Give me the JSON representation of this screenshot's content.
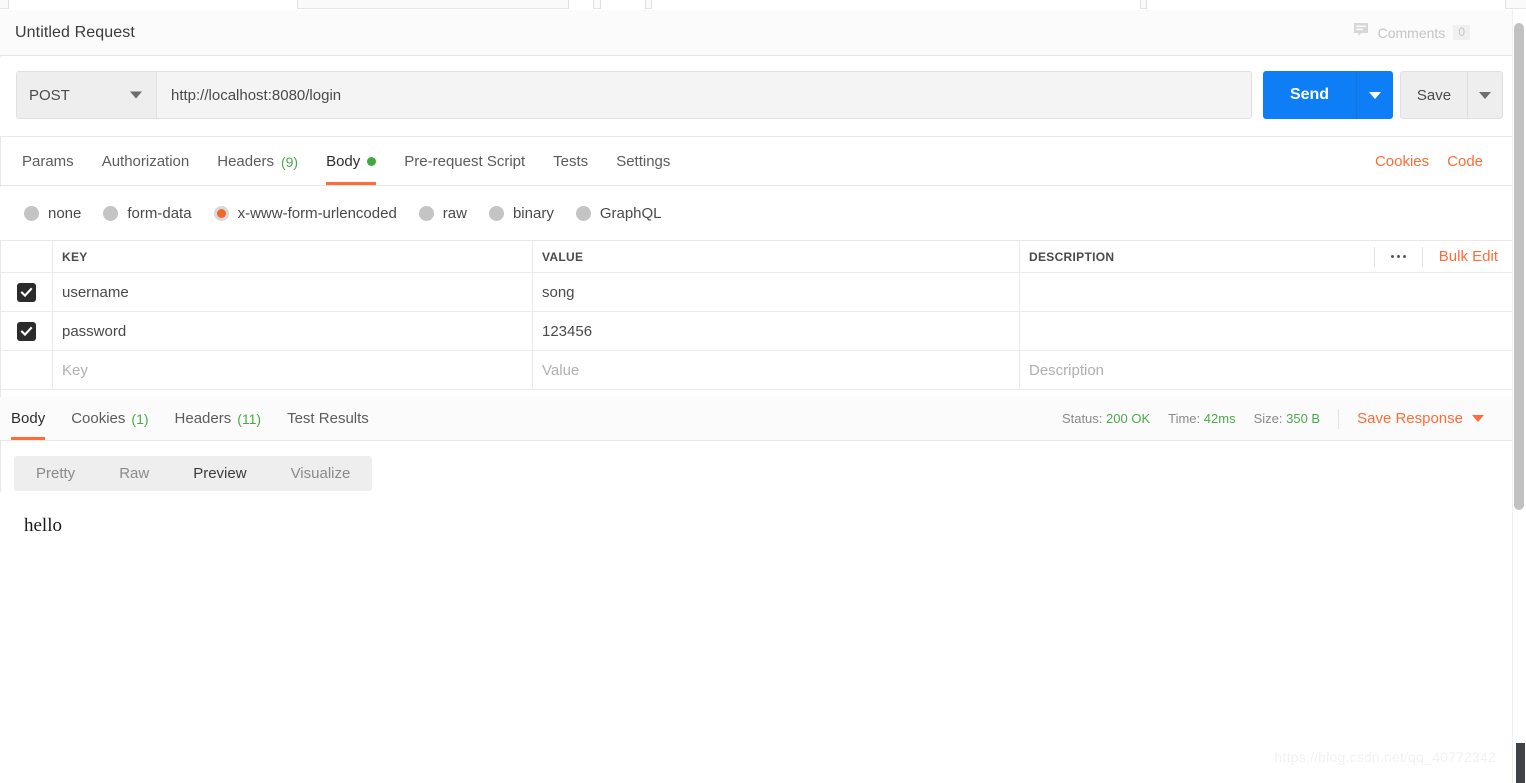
{
  "request": {
    "title": "Untitled Request",
    "comments": {
      "icon": "comment-bubble-icon",
      "label": "Comments",
      "count": "0"
    },
    "method": "POST",
    "url": "http://localhost:8080/login",
    "send_label": "Send",
    "save_label": "Save"
  },
  "request_tabs": [
    {
      "label": "Params",
      "count": "",
      "active": false,
      "dot": false
    },
    {
      "label": "Authorization",
      "count": "",
      "active": false,
      "dot": false
    },
    {
      "label": "Headers",
      "count": "(9)",
      "active": false,
      "dot": false
    },
    {
      "label": "Body",
      "count": "",
      "active": true,
      "dot": true
    },
    {
      "label": "Pre-request Script",
      "count": "",
      "active": false,
      "dot": false
    },
    {
      "label": "Tests",
      "count": "",
      "active": false,
      "dot": false
    },
    {
      "label": "Settings",
      "count": "",
      "active": false,
      "dot": false
    }
  ],
  "tabs_right": {
    "cookies": "Cookies",
    "code": "Code"
  },
  "body_types": [
    {
      "label": "none",
      "selected": false
    },
    {
      "label": "form-data",
      "selected": false
    },
    {
      "label": "x-www-form-urlencoded",
      "selected": true
    },
    {
      "label": "raw",
      "selected": false
    },
    {
      "label": "binary",
      "selected": false
    },
    {
      "label": "GraphQL",
      "selected": false
    }
  ],
  "params_table": {
    "headers": {
      "key": "KEY",
      "value": "VALUE",
      "description": "DESCRIPTION"
    },
    "more_icon": "ellipsis-icon",
    "bulk_edit": "Bulk Edit",
    "rows": [
      {
        "checked": true,
        "key": "username",
        "value": "song",
        "description": "",
        "placeholder": false
      },
      {
        "checked": true,
        "key": "password",
        "value": "123456",
        "description": "",
        "placeholder": false
      },
      {
        "checked": false,
        "key": "Key",
        "value": "Value",
        "description": "Description",
        "placeholder": true
      }
    ]
  },
  "response_tabs": [
    {
      "label": "Body",
      "count": "",
      "active": true
    },
    {
      "label": "Cookies",
      "count": "(1)",
      "active": false
    },
    {
      "label": "Headers",
      "count": "(11)",
      "active": false
    },
    {
      "label": "Test Results",
      "count": "",
      "active": false
    }
  ],
  "response_meta": {
    "status_label": "Status:",
    "status_value": "200 OK",
    "time_label": "Time:",
    "time_value": "42ms",
    "size_label": "Size:",
    "size_value": "350 B",
    "save_response": "Save Response"
  },
  "view_tabs": [
    {
      "label": "Pretty",
      "active": false
    },
    {
      "label": "Raw",
      "active": false
    },
    {
      "label": "Preview",
      "active": true
    },
    {
      "label": "Visualize",
      "active": false
    }
  ],
  "response_body": "hello",
  "watermark": "https://blog.csdn.net/qq_40772342",
  "colors": {
    "accent_orange": "#ff6c37",
    "send_blue": "#0d7ef5",
    "success_green": "#4ba94b",
    "checkbox_dark": "#2b2b2b"
  }
}
